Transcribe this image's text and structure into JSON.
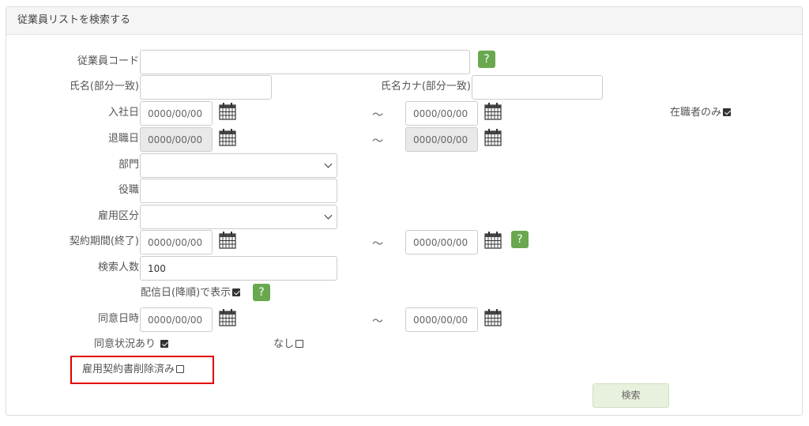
{
  "panel": {
    "title": "従業員リストを検索する"
  },
  "help_label": "?",
  "tilde": "～",
  "date_placeholder": "0000/00/00",
  "fields": {
    "employee_code": {
      "label": "従業員コード",
      "value": ""
    },
    "name": {
      "label": "氏名(部分一致)",
      "value": ""
    },
    "name_kana": {
      "label": "氏名カナ(部分一致)",
      "value": ""
    },
    "hire_date": {
      "label": "入社日"
    },
    "active_only": {
      "label": "在職者のみ",
      "checked": true
    },
    "retire_date": {
      "label": "退職日"
    },
    "department": {
      "label": "部門",
      "value": ""
    },
    "position": {
      "label": "役職",
      "value": ""
    },
    "employment_type": {
      "label": "雇用区分",
      "value": ""
    },
    "contract_end": {
      "label": "契約期間(終了)"
    },
    "search_count": {
      "label": "検索人数",
      "value": "100"
    },
    "sort_by_delivery": {
      "label": "配信日(降順)で表示",
      "checked": true
    },
    "consent_datetime": {
      "label": "同意日時"
    },
    "consent_status": {
      "label": "同意状況"
    },
    "consent_yes": {
      "label": "あり",
      "checked": true
    },
    "consent_no": {
      "label": "なし",
      "checked": false
    },
    "contract_deleted": {
      "label": "雇用契約書削除済み",
      "checked": false
    }
  },
  "search_button": {
    "label": "検索"
  },
  "colors": {
    "help_green": "#6aa84f",
    "highlight_red": "#e00000",
    "button_bg": "#e8f1dd"
  }
}
